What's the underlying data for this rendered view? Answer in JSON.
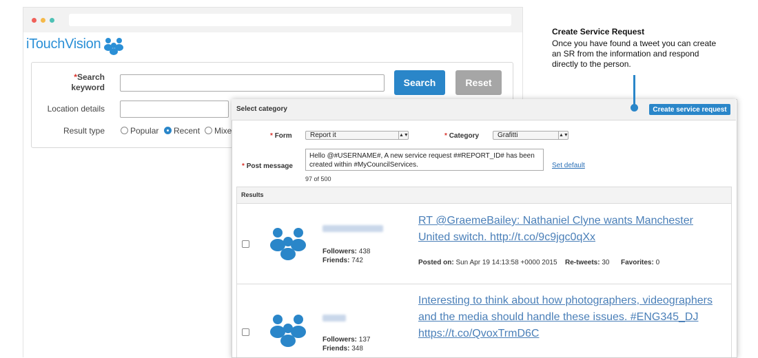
{
  "app": {
    "logo_text": "iTouchVision"
  },
  "search_form": {
    "search_keyword_label": "Search keyword",
    "location_label": "Location details",
    "result_type_label": "Result type",
    "result_types": [
      "Popular",
      "Recent",
      "Mixe"
    ],
    "selected_result_type": "Recent",
    "search_button": "Search",
    "reset_button": "Reset"
  },
  "dialog": {
    "title": "Select category",
    "create_button": "Create service request",
    "form_label": "Form",
    "form_value": "Report it",
    "category_label": "Category",
    "category_value": "Grafitti",
    "post_message_label": "Post message",
    "post_message_value": "Hello @#USERNAME#, A new service request ##REPORT_ID# has been created within #MyCouncilServices.",
    "char_count": "97 of 500",
    "set_default": "Set default",
    "results_label": "Results"
  },
  "results": [
    {
      "followers_label": "Followers:",
      "followers": "438",
      "friends_label": "Friends:",
      "friends": "742",
      "tweet": "RT @GraemeBailey: Nathaniel Clyne wants Manchester United switch. http://t.co/9c9jgc0qXx",
      "posted_label": "Posted on:",
      "posted": "Sun Apr 19 14:13:58 +0000 2015",
      "retweets_label": "Re-tweets:",
      "retweets": "30",
      "favorites_label": "Favorites:",
      "favorites": "0"
    },
    {
      "followers_label": "Followers:",
      "followers": "137",
      "friends_label": "Friends:",
      "friends": "348",
      "tweet": "Interesting to think about how photographers, videographers and the media should handle these issues. #ENG345_DJ https://t.co/QvoxTrmD6C"
    }
  ],
  "annotation": {
    "title": "Create Service Request",
    "body": "Once you have found a tweet you can create an SR from the information and respond directly to the person."
  },
  "colors": {
    "accent": "#2a86c9",
    "logo": "#2a8fd6",
    "link": "#4a7fb8"
  }
}
